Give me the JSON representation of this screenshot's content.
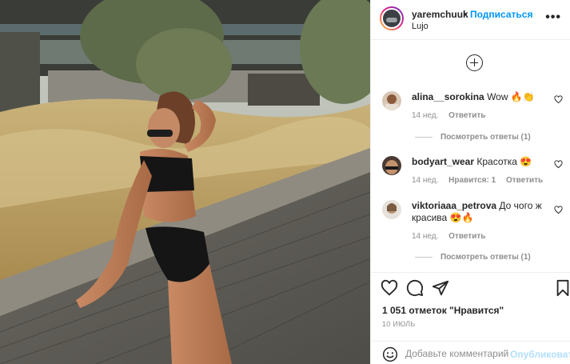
{
  "header": {
    "username": "yaremchuuk",
    "separator": "•",
    "follow_label": "Подписаться",
    "location": "Lujo",
    "more_icon": "more-horizontal-icon"
  },
  "comments": [
    {
      "username": "alina__sorokina",
      "text": "Wow 🔥👏",
      "time": "14 нед.",
      "likes": "",
      "reply_label": "Ответить",
      "replies_label": "Посмотреть ответы (1)"
    },
    {
      "username": "bodyart_wear",
      "text": "Красотка 😍",
      "time": "14 нед.",
      "likes": "Нравится: 1",
      "reply_label": "Ответить",
      "replies_label": ""
    },
    {
      "username": "viktoriaaa_petrova",
      "text": "До чого ж красива 😍🔥",
      "time": "14 нед.",
      "likes": "",
      "reply_label": "Ответить",
      "replies_label": "Посмотреть ответы (1)"
    }
  ],
  "actions": {
    "like_icon": "heart-icon",
    "comment_icon": "comment-icon",
    "share_icon": "paper-plane-icon",
    "save_icon": "bookmark-icon"
  },
  "likes_text": "1 051 отметок \"Нравится\"",
  "date": "10 ИЮЛЬ",
  "composer": {
    "placeholder": "Добавьте комментарий...",
    "publish_label": "Опубликовать"
  },
  "colors": {
    "accent": "#0095f6",
    "publish_disabled": "#b2dffc",
    "muted": "#8e8e8e",
    "text": "#262626"
  }
}
